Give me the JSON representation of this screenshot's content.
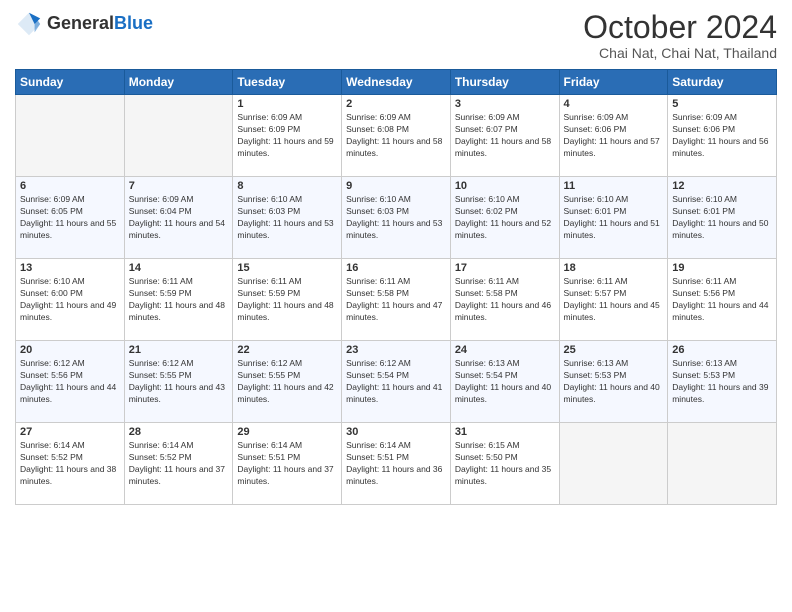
{
  "header": {
    "logo_general": "General",
    "logo_blue": "Blue",
    "month_title": "October 2024",
    "location": "Chai Nat, Chai Nat, Thailand"
  },
  "calendar": {
    "days_of_week": [
      "Sunday",
      "Monday",
      "Tuesday",
      "Wednesday",
      "Thursday",
      "Friday",
      "Saturday"
    ],
    "weeks": [
      [
        {
          "day": "",
          "info": ""
        },
        {
          "day": "",
          "info": ""
        },
        {
          "day": "1",
          "info": "Sunrise: 6:09 AM\nSunset: 6:09 PM\nDaylight: 11 hours and 59 minutes."
        },
        {
          "day": "2",
          "info": "Sunrise: 6:09 AM\nSunset: 6:08 PM\nDaylight: 11 hours and 58 minutes."
        },
        {
          "day": "3",
          "info": "Sunrise: 6:09 AM\nSunset: 6:07 PM\nDaylight: 11 hours and 58 minutes."
        },
        {
          "day": "4",
          "info": "Sunrise: 6:09 AM\nSunset: 6:06 PM\nDaylight: 11 hours and 57 minutes."
        },
        {
          "day": "5",
          "info": "Sunrise: 6:09 AM\nSunset: 6:06 PM\nDaylight: 11 hours and 56 minutes."
        }
      ],
      [
        {
          "day": "6",
          "info": "Sunrise: 6:09 AM\nSunset: 6:05 PM\nDaylight: 11 hours and 55 minutes."
        },
        {
          "day": "7",
          "info": "Sunrise: 6:09 AM\nSunset: 6:04 PM\nDaylight: 11 hours and 54 minutes."
        },
        {
          "day": "8",
          "info": "Sunrise: 6:10 AM\nSunset: 6:03 PM\nDaylight: 11 hours and 53 minutes."
        },
        {
          "day": "9",
          "info": "Sunrise: 6:10 AM\nSunset: 6:03 PM\nDaylight: 11 hours and 53 minutes."
        },
        {
          "day": "10",
          "info": "Sunrise: 6:10 AM\nSunset: 6:02 PM\nDaylight: 11 hours and 52 minutes."
        },
        {
          "day": "11",
          "info": "Sunrise: 6:10 AM\nSunset: 6:01 PM\nDaylight: 11 hours and 51 minutes."
        },
        {
          "day": "12",
          "info": "Sunrise: 6:10 AM\nSunset: 6:01 PM\nDaylight: 11 hours and 50 minutes."
        }
      ],
      [
        {
          "day": "13",
          "info": "Sunrise: 6:10 AM\nSunset: 6:00 PM\nDaylight: 11 hours and 49 minutes."
        },
        {
          "day": "14",
          "info": "Sunrise: 6:11 AM\nSunset: 5:59 PM\nDaylight: 11 hours and 48 minutes."
        },
        {
          "day": "15",
          "info": "Sunrise: 6:11 AM\nSunset: 5:59 PM\nDaylight: 11 hours and 48 minutes."
        },
        {
          "day": "16",
          "info": "Sunrise: 6:11 AM\nSunset: 5:58 PM\nDaylight: 11 hours and 47 minutes."
        },
        {
          "day": "17",
          "info": "Sunrise: 6:11 AM\nSunset: 5:58 PM\nDaylight: 11 hours and 46 minutes."
        },
        {
          "day": "18",
          "info": "Sunrise: 6:11 AM\nSunset: 5:57 PM\nDaylight: 11 hours and 45 minutes."
        },
        {
          "day": "19",
          "info": "Sunrise: 6:11 AM\nSunset: 5:56 PM\nDaylight: 11 hours and 44 minutes."
        }
      ],
      [
        {
          "day": "20",
          "info": "Sunrise: 6:12 AM\nSunset: 5:56 PM\nDaylight: 11 hours and 44 minutes."
        },
        {
          "day": "21",
          "info": "Sunrise: 6:12 AM\nSunset: 5:55 PM\nDaylight: 11 hours and 43 minutes."
        },
        {
          "day": "22",
          "info": "Sunrise: 6:12 AM\nSunset: 5:55 PM\nDaylight: 11 hours and 42 minutes."
        },
        {
          "day": "23",
          "info": "Sunrise: 6:12 AM\nSunset: 5:54 PM\nDaylight: 11 hours and 41 minutes."
        },
        {
          "day": "24",
          "info": "Sunrise: 6:13 AM\nSunset: 5:54 PM\nDaylight: 11 hours and 40 minutes."
        },
        {
          "day": "25",
          "info": "Sunrise: 6:13 AM\nSunset: 5:53 PM\nDaylight: 11 hours and 40 minutes."
        },
        {
          "day": "26",
          "info": "Sunrise: 6:13 AM\nSunset: 5:53 PM\nDaylight: 11 hours and 39 minutes."
        }
      ],
      [
        {
          "day": "27",
          "info": "Sunrise: 6:14 AM\nSunset: 5:52 PM\nDaylight: 11 hours and 38 minutes."
        },
        {
          "day": "28",
          "info": "Sunrise: 6:14 AM\nSunset: 5:52 PM\nDaylight: 11 hours and 37 minutes."
        },
        {
          "day": "29",
          "info": "Sunrise: 6:14 AM\nSunset: 5:51 PM\nDaylight: 11 hours and 37 minutes."
        },
        {
          "day": "30",
          "info": "Sunrise: 6:14 AM\nSunset: 5:51 PM\nDaylight: 11 hours and 36 minutes."
        },
        {
          "day": "31",
          "info": "Sunrise: 6:15 AM\nSunset: 5:50 PM\nDaylight: 11 hours and 35 minutes."
        },
        {
          "day": "",
          "info": ""
        },
        {
          "day": "",
          "info": ""
        }
      ]
    ]
  }
}
